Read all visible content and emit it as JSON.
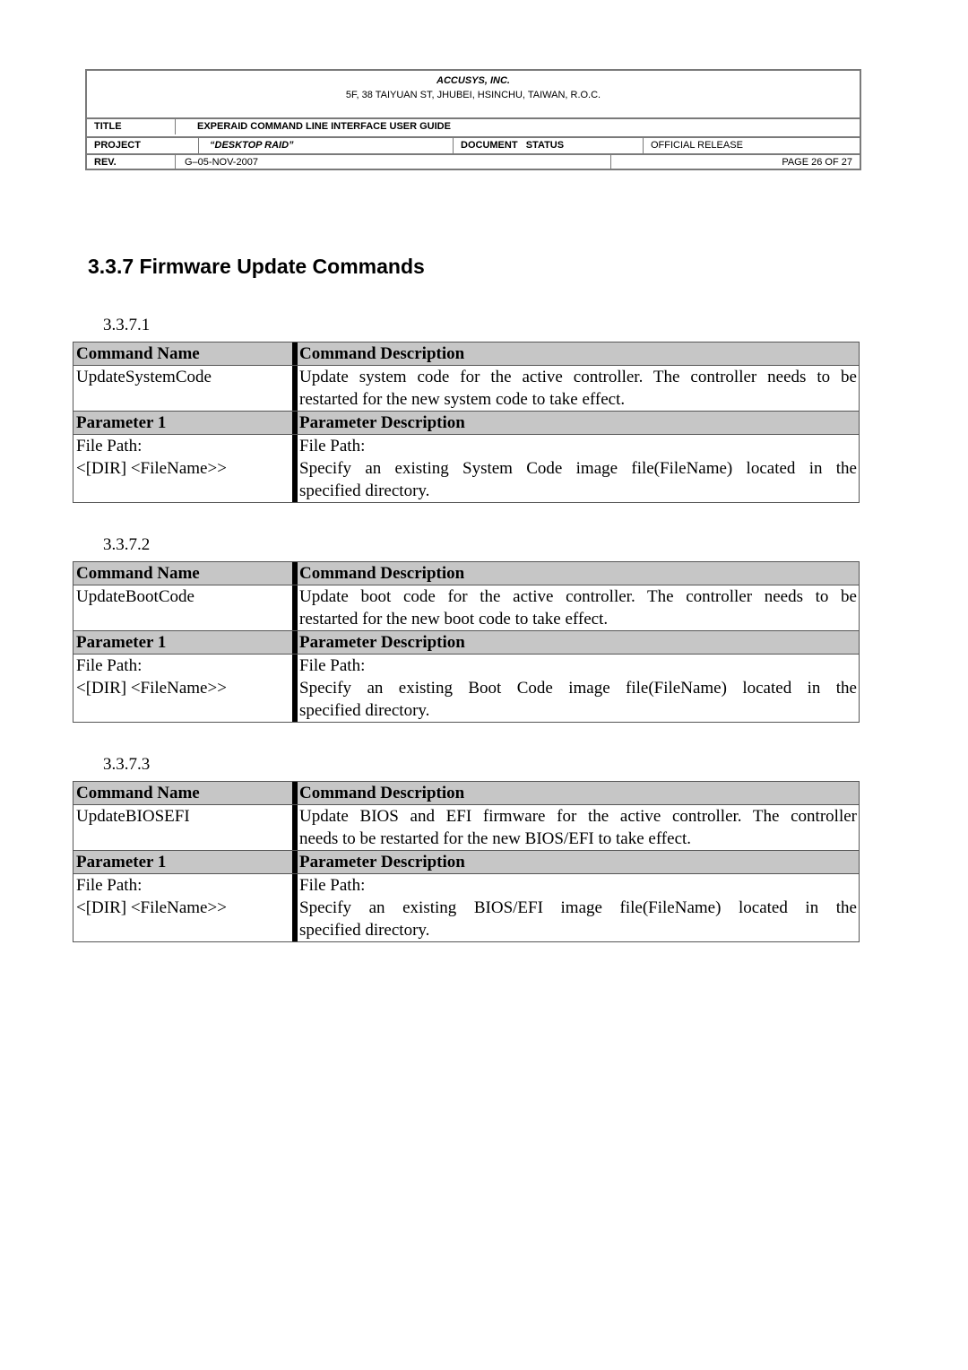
{
  "header": {
    "company": "ACCUSYS, INC.",
    "address": "5F, 38 TAIYUAN ST, JHUBEI, HSINCHU, TAIWAN, R.O.C.",
    "title_label": "TITLE",
    "title_value": "EXPERAID COMMAND LINE INTERFACE USER GUIDE",
    "project_label": "PROJECT",
    "project_value": "“DESKTOP RAID”",
    "status_label": "DOCUMENT   STATUS",
    "status_value": "OFFICIAL RELEASE",
    "rev_label": "REV.",
    "rev_value": "G–05-NOV-2007",
    "page_text": "PAGE 26 OF 27"
  },
  "section": {
    "title": "3.3.7 Firmware Update Commands"
  },
  "subsections": [
    {
      "number": "3.3.7.1",
      "cmd_name_header": "Command Name",
      "cmd_desc_header": "Command Description",
      "cmd_name": "UpdateSystemCode",
      "cmd_desc_line1": "Update system code for the active controller. The controller needs to be",
      "cmd_desc_line2": "restarted for the new system code to take effect.",
      "param_header": "Parameter 1",
      "param_desc_header": "Parameter Description",
      "param_name_line1": "File Path:",
      "param_name_line2": "<[DIR] <FileName>>",
      "param_desc_line1": "File Path:",
      "param_desc_line2": "Specify an existing System Code image file(FileName) located in the",
      "param_desc_line3": "specified directory."
    },
    {
      "number": "3.3.7.2",
      "cmd_name_header": "Command Name",
      "cmd_desc_header": "Command Description",
      "cmd_name": "UpdateBootCode",
      "cmd_desc_line1": "Update boot code for the active controller. The controller needs to be",
      "cmd_desc_line2": "restarted for the new boot code to take effect.",
      "param_header": "Parameter 1",
      "param_desc_header": "Parameter Description",
      "param_name_line1": "File Path:",
      "param_name_line2": "<[DIR] <FileName>>",
      "param_desc_line1": "File Path:",
      "param_desc_line2": "Specify an existing Boot Code image file(FileName) located in the",
      "param_desc_line3": "specified directory."
    },
    {
      "number": "3.3.7.3",
      "cmd_name_header": "Command Name",
      "cmd_desc_header": "Command Description",
      "cmd_name": "UpdateBIOSEFI",
      "cmd_desc_line1": "Update BIOS and EFI firmware for the active controller. The controller",
      "cmd_desc_line2": "needs to be restarted for the new BIOS/EFI to take effect.",
      "param_header": "Parameter 1",
      "param_desc_header": "Parameter Description",
      "param_name_line1": "File Path:",
      "param_name_line2": "<[DIR] <FileName>>",
      "param_desc_line1": "File Path:",
      "param_desc_line2": "Specify an existing BIOS/EFI image file(FileName) located in the",
      "param_desc_line3": "specified directory."
    }
  ]
}
